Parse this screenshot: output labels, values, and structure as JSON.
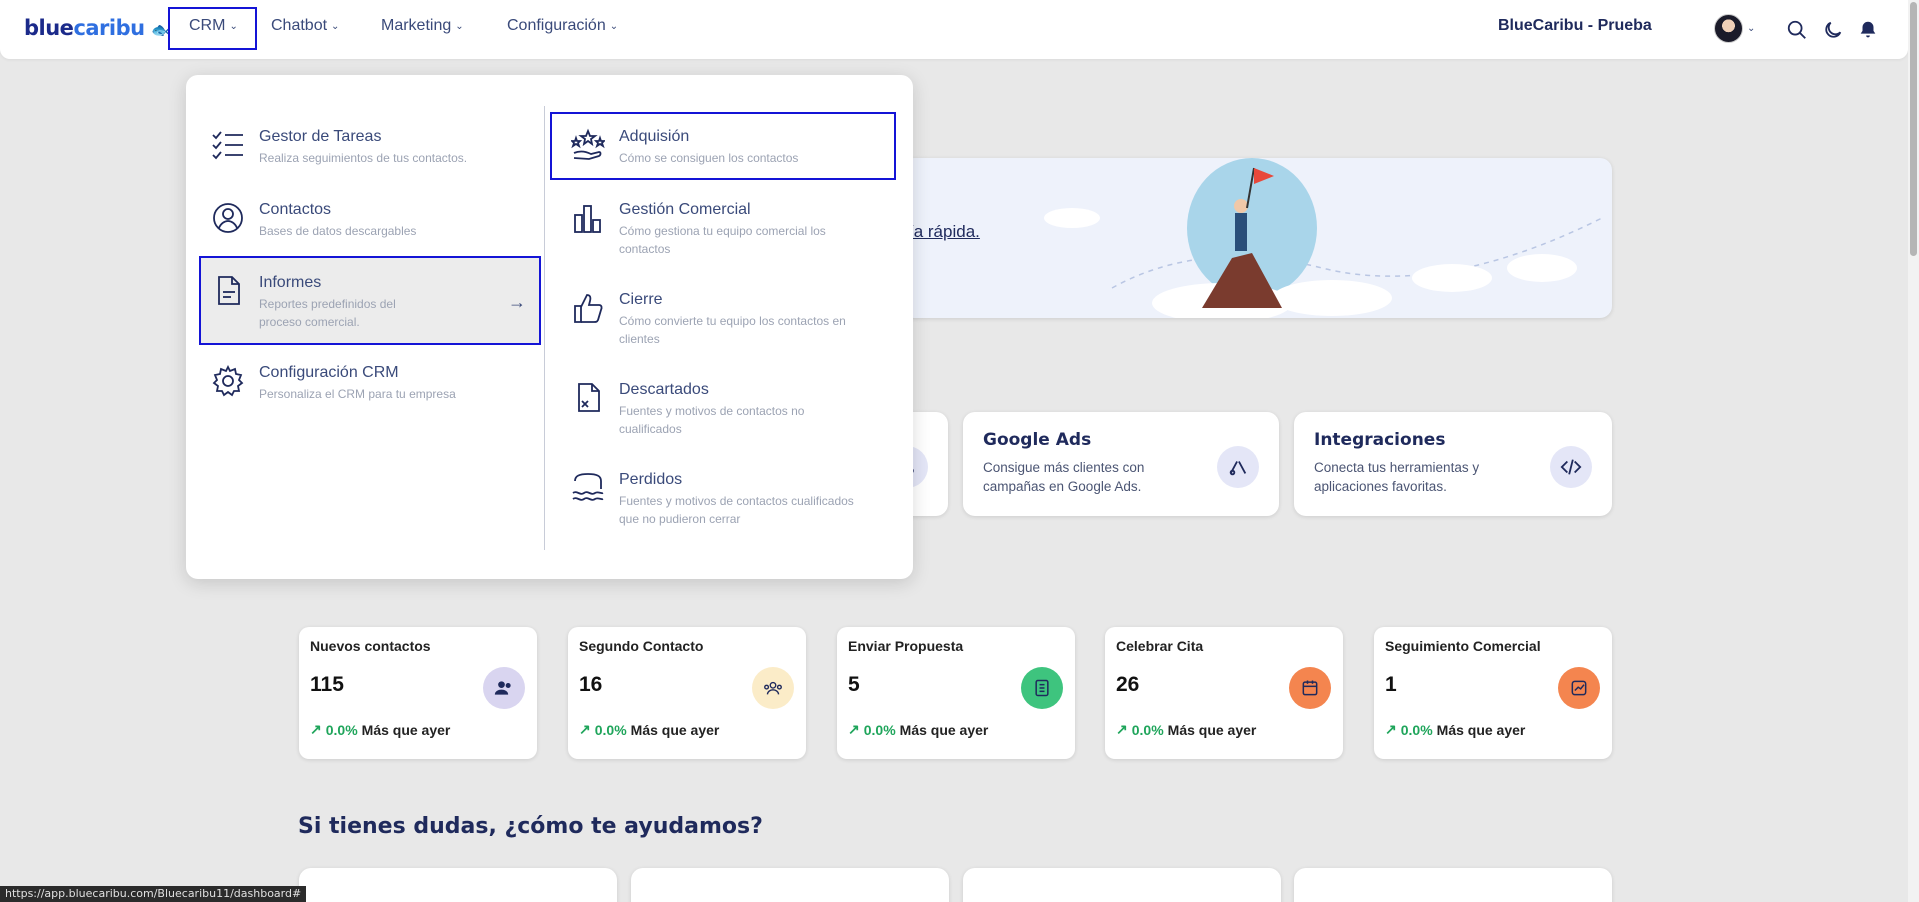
{
  "header": {
    "logo_part1": "blue",
    "logo_part2": "caribu",
    "nav": [
      {
        "label": "CRM"
      },
      {
        "label": "Chatbot"
      },
      {
        "label": "Marketing"
      },
      {
        "label": "Configuración"
      }
    ],
    "company": "BlueCaribu - Prueba"
  },
  "dropdown": {
    "left": [
      {
        "title": "Gestor de Tareas",
        "desc": "Realiza seguimientos de tus contactos."
      },
      {
        "title": "Contactos",
        "desc": "Bases de datos descargables"
      },
      {
        "title": "Informes",
        "desc": "Reportes predefinidos del proceso comercial."
      },
      {
        "title": "Configuración CRM",
        "desc": "Personaliza el CRM para tu empresa"
      }
    ],
    "right": [
      {
        "title": "Adquisión",
        "desc": "Cómo se consiguen los contactos"
      },
      {
        "title": "Gestión Comercial",
        "desc": "Cómo gestiona tu equipo comercial los contactos"
      },
      {
        "title": "Cierre",
        "desc": "Cómo convierte tu equipo los contactos en clientes"
      },
      {
        "title": "Descartados",
        "desc": "Fuentes y motivos de contactos no cualificados"
      },
      {
        "title": "Perdidos",
        "desc": "Fuentes y motivos de contactos cualificados que no pudieron cerrar"
      }
    ]
  },
  "banner": {
    "link_text": "ía rápida."
  },
  "integration_cards": [
    {
      "title": "Google Ads",
      "desc": "Consigue más clientes con campañas en Google Ads."
    },
    {
      "title": "Integraciones",
      "desc": "Conecta tus herramientas y aplicaciones favoritas."
    }
  ],
  "stats": [
    {
      "title": "Nuevos contactos",
      "value": "115",
      "pct": "0.0%",
      "trend": "Más que ayer",
      "color": "#d9d5f0"
    },
    {
      "title": "Segundo Contacto",
      "value": "16",
      "pct": "0.0%",
      "trend": "Más que ayer",
      "color": "#fbecc8"
    },
    {
      "title": "Enviar Propuesta",
      "value": "5",
      "pct": "0.0%",
      "trend": "Más que ayer",
      "color": "#3ec47e"
    },
    {
      "title": "Celebrar Cita",
      "value": "26",
      "pct": "0.0%",
      "trend": "Más que ayer",
      "color": "#f4854f"
    },
    {
      "title": "Seguimiento Comercial",
      "value": "1",
      "pct": "0.0%",
      "trend": "Más que ayer",
      "color": "#f4854f"
    }
  ],
  "help": {
    "title": "Si tienes dudas, ¿cómo te ayudamos?"
  },
  "status_bar": {
    "url": "https://app.bluecaribu.com/Bluecaribu11/dashboard#"
  }
}
